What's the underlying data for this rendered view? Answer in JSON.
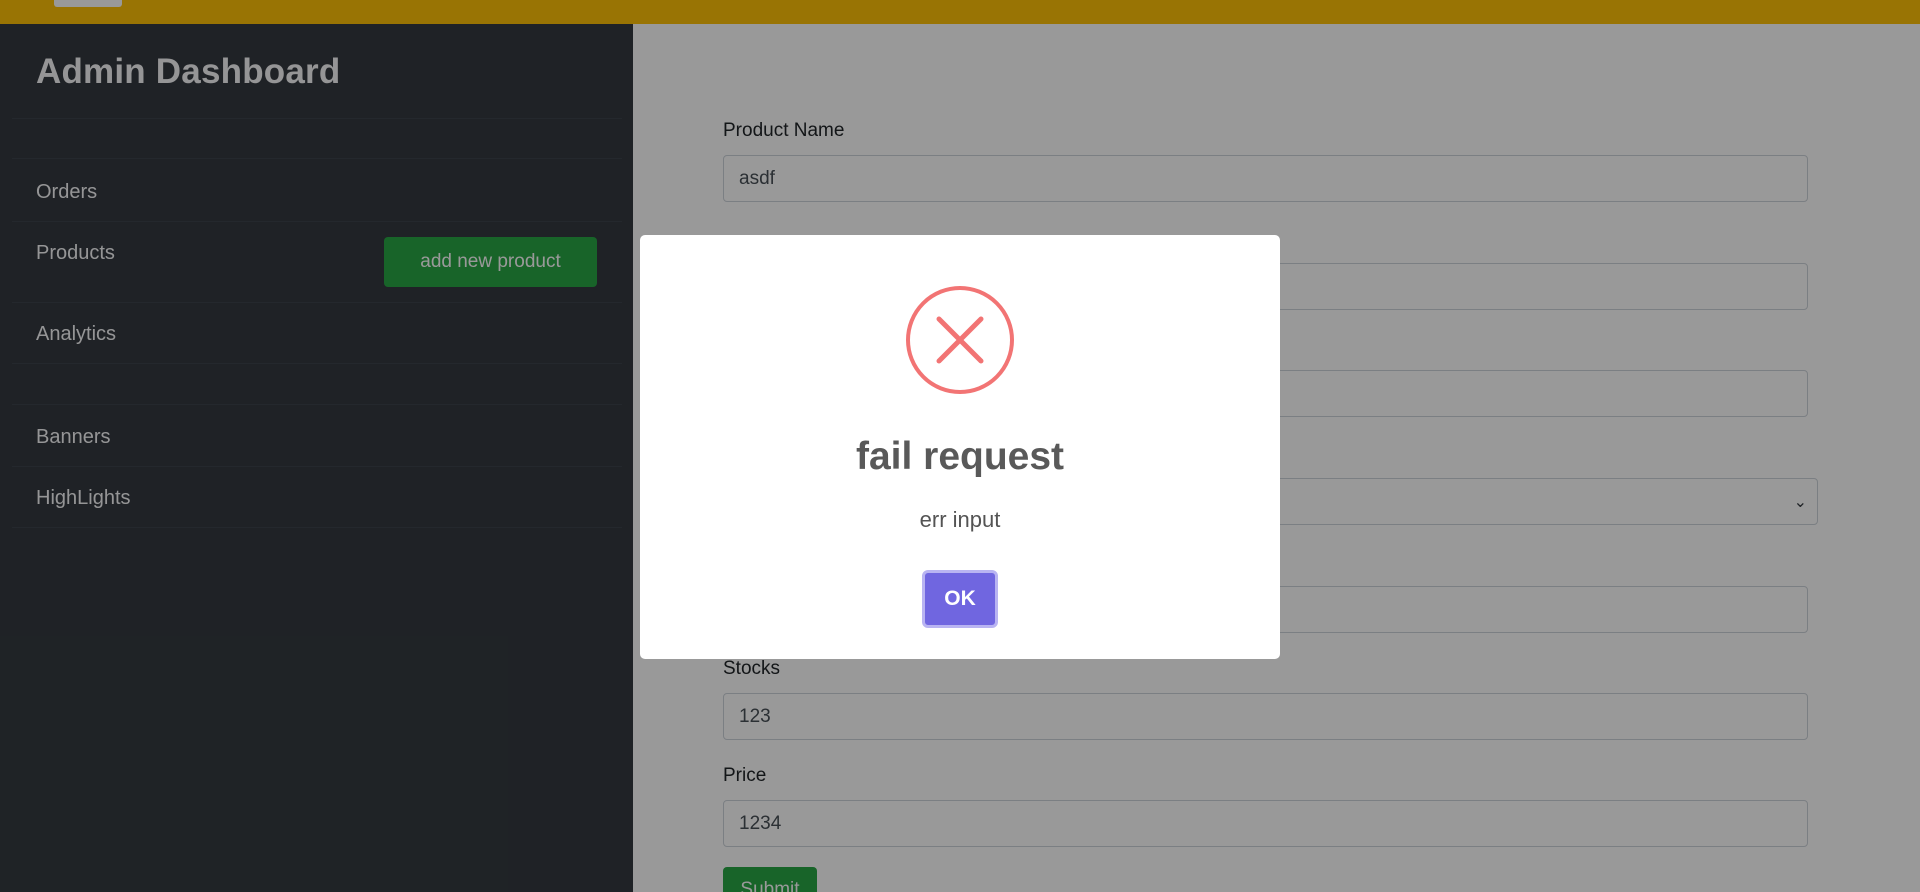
{
  "sidebar": {
    "title": "Admin Dashboard",
    "items": [
      {
        "label": "Orders"
      },
      {
        "label": "Products"
      },
      {
        "label": "Analytics"
      },
      {
        "label": "Banners"
      },
      {
        "label": "HighLights"
      }
    ],
    "add_button_label": "add new product"
  },
  "form": {
    "product_name_label": "Product Name",
    "product_name_value": "asdf",
    "stocks_label": "Stocks",
    "stocks_value": "123",
    "price_label": "Price",
    "price_value": "1234",
    "submit_label": "Submit"
  },
  "modal": {
    "icon": "error-x-icon",
    "title": "fail request",
    "text": "err input",
    "ok_label": "OK"
  },
  "colors": {
    "topbar": "#ffc107",
    "sidebar": "#343a40",
    "success": "#28a745",
    "error": "#f27474",
    "confirm": "#7066e0"
  }
}
